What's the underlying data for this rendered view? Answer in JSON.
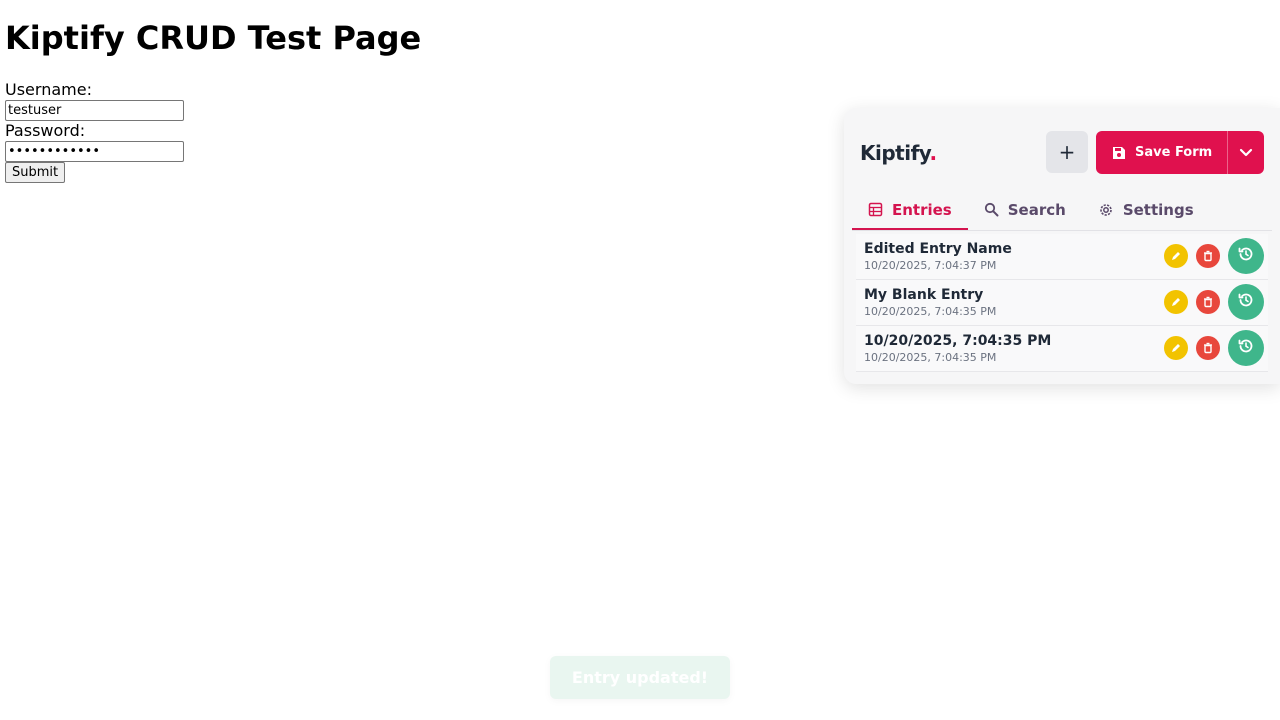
{
  "page": {
    "title": "Kiptify CRUD Test Page",
    "form": {
      "username_label": "Username:",
      "username_value": "testuser",
      "password_label": "Password:",
      "password_value": "testpass1234",
      "submit_label": "Submit"
    }
  },
  "kiptify": {
    "logo_text": "Kiptify",
    "logo_dot": ".",
    "add_button_label": "+",
    "save_button_label": "Save Form",
    "tabs": [
      {
        "label": "Entries",
        "icon": "table-icon",
        "active": true
      },
      {
        "label": "Search",
        "icon": "search-icon",
        "active": false
      },
      {
        "label": "Settings",
        "icon": "gear-icon",
        "active": false
      }
    ],
    "entries": [
      {
        "name": "Edited Entry Name",
        "date": "10/20/2025, 7:04:37 PM"
      },
      {
        "name": "My Blank Entry",
        "date": "10/20/2025, 7:04:35 PM"
      },
      {
        "name": "10/20/2025, 7:04:35 PM",
        "date": "10/20/2025, 7:04:35 PM"
      }
    ],
    "colors": {
      "brand": "#e0114e",
      "edit": "#f2c300",
      "delete": "#e8473c",
      "load": "#3fb68b"
    }
  },
  "toast": {
    "message": "Entry updated!"
  }
}
